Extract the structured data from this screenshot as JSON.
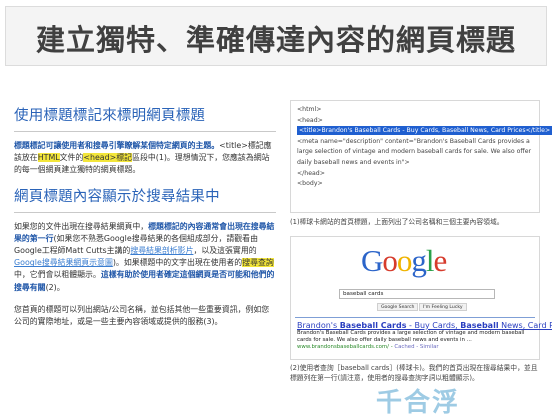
{
  "slide": {
    "title": "建立獨特、準確傳達內容的網頁標題"
  },
  "section1": {
    "heading": "使用標題標記來標明網頁標題",
    "p_part1": "標題標記可讓使用者和搜尋引擎瞭解某個特定網頁的主題。",
    "p_part2": "<title>標記應該放在",
    "p_html": "HTML",
    "p_part3": "文件的",
    "p_head": "<head>標記",
    "p_part4": "區段中(1)。理想情況下，您應該為網站的每一個網頁建立獨特的網頁標題。"
  },
  "section2": {
    "heading": "網頁標題內容顯示於搜尋結果中",
    "p1_part1": "如果您的文件出現在搜尋結果網頁中，",
    "p1_bold1": "標題標記的內容通常會出現在搜尋結果的第一行",
    "p1_part2": "(如果您不熟悉Google搜尋結果的各個組成部分，請觀看由Google工程師Matt Cutts主講的",
    "p1_link1": "搜尋結果剖析影片",
    "p1_part3": "，以及這張實用的",
    "p1_link2": "Google搜尋結果網頁示意圖",
    "p1_part4": ")。如果標題中的文字出現在使用者的",
    "p1_hl": "搜尋查詢",
    "p1_part5": "中，它們會以粗體顯示。",
    "p1_bold2": "這樣有助於使用者確定這個網頁是否可能和他們的搜尋有關",
    "p1_part6": "(2)。",
    "p2": "您首頁的標題可以列出網站/公司名稱，並包括其他一些重要資訊，例如您公司的實際地址，或是一些主要內容領域或提供的服務(3)。"
  },
  "code_example": {
    "lines": [
      "<html>",
      "<head>"
    ],
    "title_line": "<title>Brandon's Baseball Cards - Buy Cards, Baseball News, Card Prices</title>",
    "meta_line": "<meta name=\"description\" content=\"Brandon's Baseball Cards provides a large selection of vintage and modern baseball cards for sale. We also offer daily baseball news and events in\">",
    "closing": [
      "</head>",
      "<body>"
    ],
    "caption": "(1)棒球卡網站的首頁標題，上面列出了公司名稱和三個主要內容領域。"
  },
  "serp_example": {
    "logo": [
      "G",
      "o",
      "o",
      "g",
      "l",
      "e"
    ],
    "query": "baseball cards",
    "button1": "Google Search",
    "button2": "I'm Feeling Lucky",
    "result_title_pre": "Brandon's ",
    "result_title_bold": "Baseball Cards",
    "result_title_mid": " - Buy Cards, ",
    "result_title_bold2": "Baseball",
    "result_title_post": " News, Card Prices",
    "result_desc": "Brandon's Baseball Cards provides a large selection of vintage and modern baseball cards for sale. We also offer daily baseball news and events in ...",
    "result_url": "www.brandonsbaseballcards.com/ - ",
    "result_links": "Cached - Similar",
    "caption": "(2)使用者查詢［baseball cards］(棒球卡)。我們的首頁出現在搜尋結果中，並且標題列在第一行(請注意，使用者的搜尋查詢字詞以粗體顯示)。"
  },
  "watermark": "千合浮"
}
